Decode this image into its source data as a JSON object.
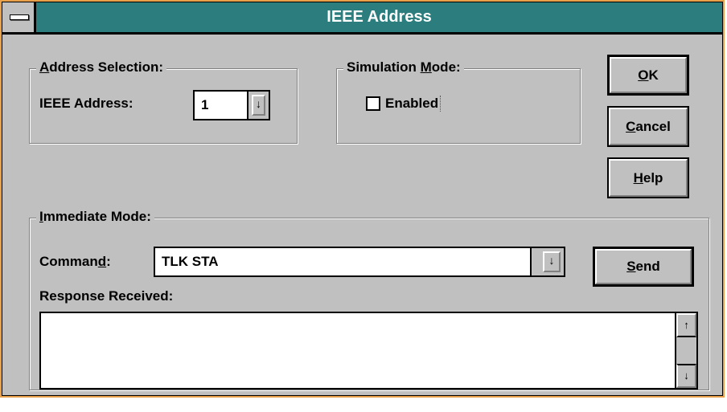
{
  "window": {
    "title": "IEEE Address"
  },
  "address_selection": {
    "group_label_pre": "",
    "group_label_u": "A",
    "group_label_post": "ddress Selection:",
    "ieee_label": "IEEE Address:",
    "ieee_value": "1"
  },
  "simulation_mode": {
    "group_label_pre": "Simulation ",
    "group_label_u": "M",
    "group_label_post": "ode:",
    "enabled_label": "Enabled",
    "enabled_checked": false
  },
  "buttons": {
    "ok_u": "O",
    "ok_post": "K",
    "cancel_u": "C",
    "cancel_post": "ancel",
    "help_u": "H",
    "help_post": "elp",
    "send_u": "S",
    "send_post": "end"
  },
  "immediate_mode": {
    "group_label_pre": "",
    "group_label_u": "I",
    "group_label_post": "mmediate Mode:",
    "command_label_pre": "Comman",
    "command_label_u": "d",
    "command_label_post": ":",
    "command_value": "TLK STA",
    "response_label": "Response Received:",
    "response_value": ""
  },
  "icons": {
    "dropdown": "↓",
    "scroll_up": "↑",
    "scroll_down": "↓"
  }
}
